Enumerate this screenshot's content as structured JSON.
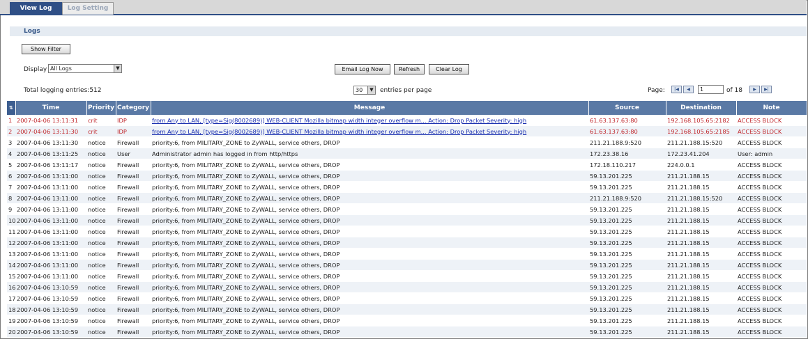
{
  "tabs": [
    {
      "label": "View Log",
      "active": true
    },
    {
      "label": "Log Setting",
      "active": false
    }
  ],
  "section_title": "Logs",
  "show_filter_label": "Show Filter",
  "display": {
    "label": "Display",
    "value": "All Logs"
  },
  "actions": {
    "email": "Email Log Now",
    "refresh": "Refresh",
    "clear": "Clear Log"
  },
  "total_entries": "Total logging entries:512",
  "per_page": {
    "value": "30",
    "label": "entries per page"
  },
  "pager": {
    "label": "Page:",
    "current": "1",
    "of": "of 18"
  },
  "columns": [
    "#",
    "Time",
    "Priority",
    "Category",
    "Message",
    "Source",
    "Destination",
    "Note"
  ],
  "colors": {
    "header_bg": "#5a79a5",
    "tab_active": "#2f4f86",
    "crit_text": "#c0282d",
    "link": "#1a2fb0"
  },
  "rows": [
    {
      "n": "1",
      "time": "2007-04-06 13:11:31",
      "priority": "crit",
      "category": "IDP",
      "message": "from Any to LAN, [type=Sig(8002689)] WEB-CLIENT Mozilla bitmap width integer overflow m... Action: Drop Packet Severity: high",
      "source": "61.63.137.63:80",
      "destination": "192.168.105.65:2182",
      "note": "ACCESS BLOCK"
    },
    {
      "n": "2",
      "time": "2007-04-06 13:11:30",
      "priority": "crit",
      "category": "IDP",
      "message": "from Any to LAN, [type=Sig(8002689)] WEB-CLIENT Mozilla bitmap width integer overflow m... Action: Drop Packet Severity: high",
      "source": "61.63.137.63:80",
      "destination": "192.168.105.65:2185",
      "note": "ACCESS BLOCK"
    },
    {
      "n": "3",
      "time": "2007-04-06 13:11:30",
      "priority": "notice",
      "category": "Firewall",
      "message": "priority:6, from MILITARY_ZONE to ZyWALL, service others, DROP",
      "source": "211.21.188.9:520",
      "destination": "211.21.188.15:520",
      "note": "ACCESS BLOCK"
    },
    {
      "n": "4",
      "time": "2007-04-06 13:11:25",
      "priority": "notice",
      "category": "User",
      "message": "Administrator admin has logged in from http/https",
      "source": "172.23.38.16",
      "destination": "172.23.41.204",
      "note": "User: admin"
    },
    {
      "n": "5",
      "time": "2007-04-06 13:11:17",
      "priority": "notice",
      "category": "Firewall",
      "message": "priority:6, from MILITARY_ZONE to ZyWALL, service others, DROP",
      "source": "172.18.110.217",
      "destination": "224.0.0.1",
      "note": "ACCESS BLOCK"
    },
    {
      "n": "6",
      "time": "2007-04-06 13:11:00",
      "priority": "notice",
      "category": "Firewall",
      "message": "priority:6, from MILITARY_ZONE to ZyWALL, service others, DROP",
      "source": "59.13.201.225",
      "destination": "211.21.188.15",
      "note": "ACCESS BLOCK"
    },
    {
      "n": "7",
      "time": "2007-04-06 13:11:00",
      "priority": "notice",
      "category": "Firewall",
      "message": "priority:6, from MILITARY_ZONE to ZyWALL, service others, DROP",
      "source": "59.13.201.225",
      "destination": "211.21.188.15",
      "note": "ACCESS BLOCK"
    },
    {
      "n": "8",
      "time": "2007-04-06 13:11:00",
      "priority": "notice",
      "category": "Firewall",
      "message": "priority:6, from MILITARY_ZONE to ZyWALL, service others, DROP",
      "source": "211.21.188.9:520",
      "destination": "211.21.188.15:520",
      "note": "ACCESS BLOCK"
    },
    {
      "n": "9",
      "time": "2007-04-06 13:11:00",
      "priority": "notice",
      "category": "Firewall",
      "message": "priority:6, from MILITARY_ZONE to ZyWALL, service others, DROP",
      "source": "59.13.201.225",
      "destination": "211.21.188.15",
      "note": "ACCESS BLOCK"
    },
    {
      "n": "10",
      "time": "2007-04-06 13:11:00",
      "priority": "notice",
      "category": "Firewall",
      "message": "priority:6, from MILITARY_ZONE to ZyWALL, service others, DROP",
      "source": "59.13.201.225",
      "destination": "211.21.188.15",
      "note": "ACCESS BLOCK"
    },
    {
      "n": "11",
      "time": "2007-04-06 13:11:00",
      "priority": "notice",
      "category": "Firewall",
      "message": "priority:6, from MILITARY_ZONE to ZyWALL, service others, DROP",
      "source": "59.13.201.225",
      "destination": "211.21.188.15",
      "note": "ACCESS BLOCK"
    },
    {
      "n": "12",
      "time": "2007-04-06 13:11:00",
      "priority": "notice",
      "category": "Firewall",
      "message": "priority:6, from MILITARY_ZONE to ZyWALL, service others, DROP",
      "source": "59.13.201.225",
      "destination": "211.21.188.15",
      "note": "ACCESS BLOCK"
    },
    {
      "n": "13",
      "time": "2007-04-06 13:11:00",
      "priority": "notice",
      "category": "Firewall",
      "message": "priority:6, from MILITARY_ZONE to ZyWALL, service others, DROP",
      "source": "59.13.201.225",
      "destination": "211.21.188.15",
      "note": "ACCESS BLOCK"
    },
    {
      "n": "14",
      "time": "2007-04-06 13:11:00",
      "priority": "notice",
      "category": "Firewall",
      "message": "priority:6, from MILITARY_ZONE to ZyWALL, service others, DROP",
      "source": "59.13.201.225",
      "destination": "211.21.188.15",
      "note": "ACCESS BLOCK"
    },
    {
      "n": "15",
      "time": "2007-04-06 13:11:00",
      "priority": "notice",
      "category": "Firewall",
      "message": "priority:6, from MILITARY_ZONE to ZyWALL, service others, DROP",
      "source": "59.13.201.225",
      "destination": "211.21.188.15",
      "note": "ACCESS BLOCK"
    },
    {
      "n": "16",
      "time": "2007-04-06 13:10:59",
      "priority": "notice",
      "category": "Firewall",
      "message": "priority:6, from MILITARY_ZONE to ZyWALL, service others, DROP",
      "source": "59.13.201.225",
      "destination": "211.21.188.15",
      "note": "ACCESS BLOCK"
    },
    {
      "n": "17",
      "time": "2007-04-06 13:10:59",
      "priority": "notice",
      "category": "Firewall",
      "message": "priority:6, from MILITARY_ZONE to ZyWALL, service others, DROP",
      "source": "59.13.201.225",
      "destination": "211.21.188.15",
      "note": "ACCESS BLOCK"
    },
    {
      "n": "18",
      "time": "2007-04-06 13:10:59",
      "priority": "notice",
      "category": "Firewall",
      "message": "priority:6, from MILITARY_ZONE to ZyWALL, service others, DROP",
      "source": "59.13.201.225",
      "destination": "211.21.188.15",
      "note": "ACCESS BLOCK"
    },
    {
      "n": "19",
      "time": "2007-04-06 13:10:59",
      "priority": "notice",
      "category": "Firewall",
      "message": "priority:6, from MILITARY_ZONE to ZyWALL, service others, DROP",
      "source": "59.13.201.225",
      "destination": "211.21.188.15",
      "note": "ACCESS BLOCK"
    },
    {
      "n": "20",
      "time": "2007-04-06 13:10:59",
      "priority": "notice",
      "category": "Firewall",
      "message": "priority:6, from MILITARY_ZONE to ZyWALL, service others, DROP",
      "source": "59.13.201.225",
      "destination": "211.21.188.15",
      "note": "ACCESS BLOCK"
    }
  ]
}
